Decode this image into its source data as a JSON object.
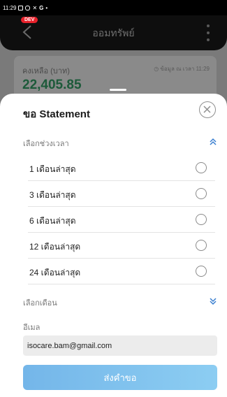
{
  "status_bar": {
    "time": "11:29",
    "icons": [
      "gallery-icon",
      "instagram-icon",
      "x-icon",
      "g-icon",
      "dot-icon"
    ]
  },
  "header": {
    "title": "ออมทรัพย์",
    "dev_badge": "DEV"
  },
  "balance": {
    "label": "คงเหลือ (บาท)",
    "value": "22,405.85",
    "updated": "ข้อมูล ณ เวลา 11:29"
  },
  "sheet": {
    "title": "ขอ Statement",
    "period_section": "เลือกช่วงเวลา",
    "options": [
      {
        "label": "1 เดือนล่าสุด"
      },
      {
        "label": "3 เดือนล่าสุด"
      },
      {
        "label": "6 เดือนล่าสุด"
      },
      {
        "label": "12 เดือนล่าสุด"
      },
      {
        "label": "24 เดือนล่าสุด"
      }
    ],
    "month_section": "เลือกเดือน",
    "email_label": "อีเมล",
    "email_value": "isocare.bam@gmail.com",
    "submit_label": "ส่งคำขอ"
  },
  "colors": {
    "accent": "#7ab8ea",
    "chevron": "#3a7fd0",
    "balance": "#1d5a3a",
    "dev_badge": "#e8212b"
  }
}
